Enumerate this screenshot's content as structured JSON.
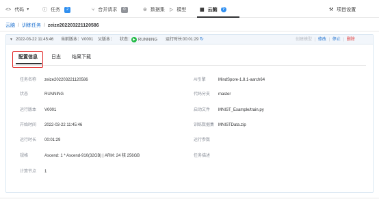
{
  "topnav": {
    "items": [
      {
        "label": "代码",
        "icon": "code-icon"
      },
      {
        "label": "任务",
        "icon": "info-circle-icon",
        "badge": "2"
      },
      {
        "label": "合并请求",
        "icon": "merge-icon",
        "badge": "0"
      },
      {
        "label": "数据集",
        "icon": "dataset-icon"
      },
      {
        "label": "模型",
        "icon": "model-icon"
      },
      {
        "label": "云脑",
        "icon": "cloudbrain-icon"
      },
      {
        "label": "项目设置",
        "icon": "settings-icon"
      }
    ]
  },
  "breadcrumb": {
    "root": "云脑",
    "section": "训练任务",
    "current": "zeize202203221120586"
  },
  "task_header": {
    "timestamp": "2022-03-22 11:45:46",
    "current_version": "当前版本：V0001",
    "parent_version": "父版本：",
    "status_label": "状态：",
    "status_value": "RUNNING",
    "duration_label": "运行时长：",
    "duration_value": "00:01:29",
    "actions": {
      "create_model": "创建模型",
      "modify": "修改",
      "stop": "停止",
      "delete": "删除"
    }
  },
  "tabs": [
    "配置信息",
    "日志",
    "结果下载"
  ],
  "details_left": [
    {
      "label": "任务名称",
      "value": "zeize202203221120586"
    },
    {
      "label": "状态",
      "value": "RUNNING"
    },
    {
      "label": "运行版本",
      "value": "V0001"
    },
    {
      "label": "开始时间",
      "value": "2022-03-22 11:45:46"
    },
    {
      "label": "运行时长",
      "value": "00:01:29"
    },
    {
      "label": "规格",
      "value": "Ascend: 1 * Ascend-910(32GB) | ARM: 24 核 256GB"
    },
    {
      "label": "计算节点",
      "value": "1"
    }
  ],
  "details_right": [
    {
      "label": "AI引擎",
      "value": "MindSpore-1.8.1-aarch64"
    },
    {
      "label": "代码分支",
      "value": "master"
    },
    {
      "label": "启动文件",
      "value": "MNIST_Example/train.py"
    },
    {
      "label": "训练数据集",
      "value": "MNISTData.zip"
    },
    {
      "label": "运行参数",
      "value": ""
    },
    {
      "label": "任务描述",
      "value": ""
    }
  ],
  "colors": {
    "accent": "#1a6fcf",
    "running": "#21ba45",
    "danger": "#e03c3c",
    "highlight": "#e02020"
  }
}
